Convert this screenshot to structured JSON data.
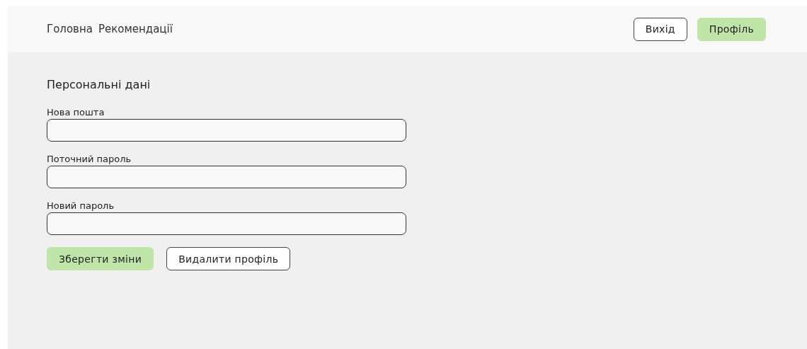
{
  "nav": {
    "links": [
      {
        "label": "Головна"
      },
      {
        "label": "Рекомендації"
      }
    ],
    "buttons": [
      {
        "label": "Вихід",
        "kind": "outline"
      },
      {
        "label": "Профіль",
        "kind": "primary"
      }
    ]
  },
  "form": {
    "title": "Персональні дані",
    "fields": [
      {
        "label": "Нова пошта"
      },
      {
        "label": "Поточний пароль"
      },
      {
        "label": "Новий пароль"
      }
    ],
    "buttons": [
      {
        "label": "Зберегти зміни",
        "kind": "primary"
      },
      {
        "label": "Видалити профіль",
        "kind": "outline"
      }
    ]
  }
}
